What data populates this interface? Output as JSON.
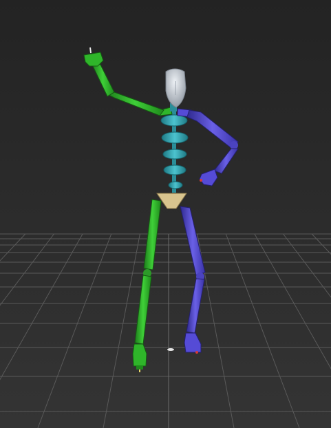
{
  "viewport": {
    "background_top": "#232323",
    "background_bottom": "#353535",
    "grid_color": "#5a5a5a",
    "grid_highlight": "#6b6b6b"
  },
  "biped": {
    "head_color": "#c9d0d8",
    "spine_color": "#3aa7b3",
    "pelvis_color": "#d8c48e",
    "left_side_color": "#2fae2a",
    "right_side_color": "#4f46c9",
    "accent_color": "#d23a3a"
  }
}
